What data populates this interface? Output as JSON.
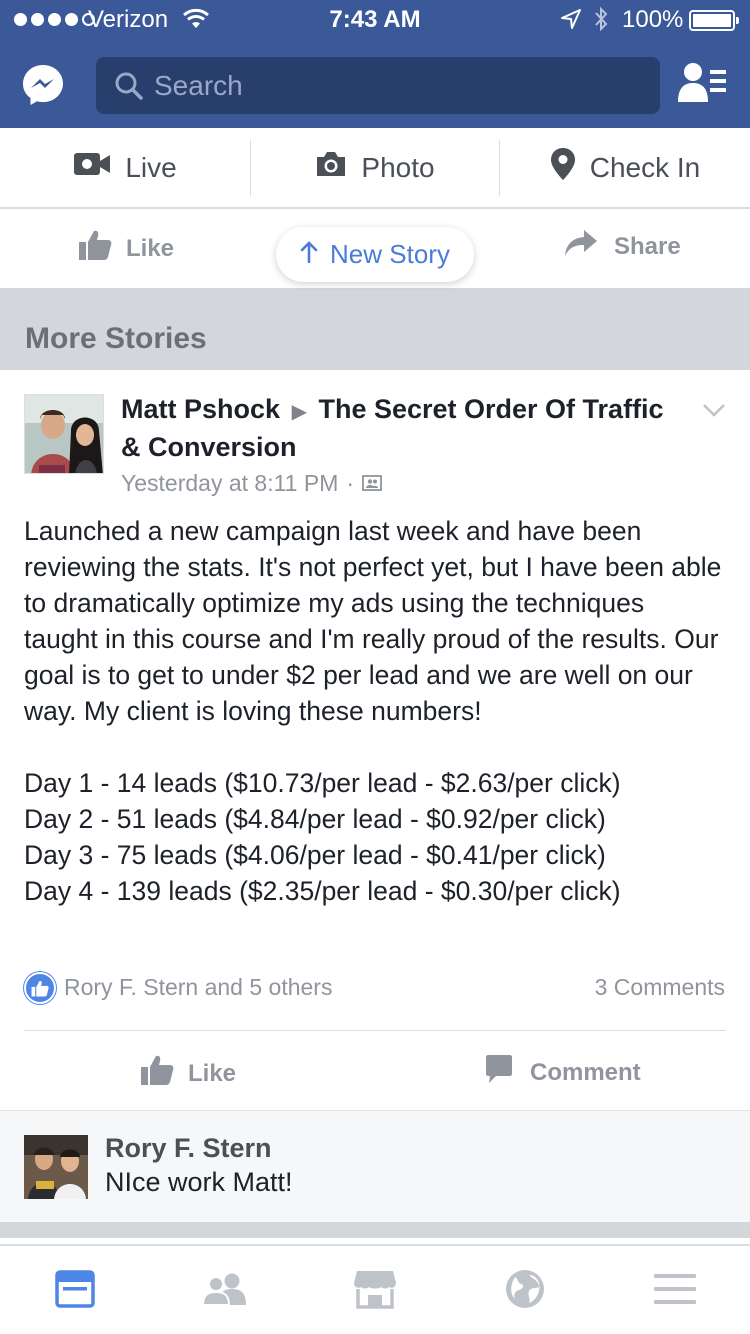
{
  "status_bar": {
    "carrier": "Verizon",
    "time": "7:43 AM",
    "battery": "100%",
    "battery_level": 1.0
  },
  "header": {
    "search_placeholder": "Search",
    "icons": [
      "messenger-icon",
      "search-icon",
      "friend-requests-icon"
    ],
    "colors": {
      "brand": "#3b5998",
      "search_bg": "#283e6d"
    }
  },
  "composer": {
    "live": "Live",
    "photo": "Photo",
    "check_in": "Check In"
  },
  "prev_story": {
    "like": "Like",
    "share": "Share"
  },
  "new_story_pill": "New Story",
  "section_title": "More Stories",
  "post": {
    "author": "Matt Pshock",
    "group": "The Secret Order Of Traffic & Conversion",
    "timestamp": "Yesterday at 8:11 PM",
    "separator": "·",
    "body": "Launched a new campaign last week and have been reviewing the stats. It's not perfect yet, but I have been able to dramatically optimize my ads using the techniques taught in this course and I'm really proud of the results. Our goal is to get to under $2 per lead and we are well on our way. My client is loving these numbers!\n\nDay 1 - 14 leads ($10.73/per lead - $2.63/per click)\nDay 2 - 51 leads ($4.84/per lead - $0.92/per click)\nDay 3 - 75 leads ($4.06/per lead - $0.41/per click)\nDay 4 - 139 leads ($2.35/per lead - $0.30/per click)",
    "reactions": "Rory F. Stern and 5 others",
    "comments_count": "3 Comments",
    "like": "Like",
    "comment": "Comment"
  },
  "comment_preview": {
    "name": "Rory F. Stern",
    "text": "NIce work Matt!"
  },
  "tabbar": {
    "tabs": [
      "news-feed",
      "friends",
      "marketplace",
      "notifications",
      "menu"
    ],
    "active": "news-feed",
    "active_color": "#4e86e6",
    "inactive_color": "#bec2c9"
  }
}
